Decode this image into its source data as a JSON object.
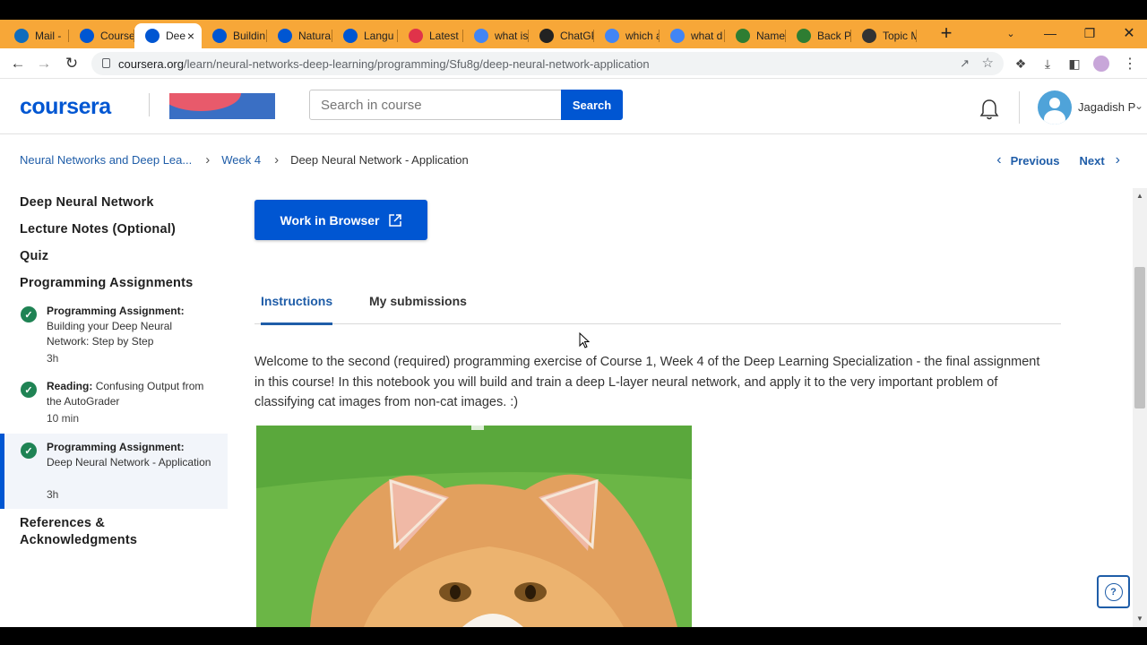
{
  "browser": {
    "tabs": [
      {
        "label": "Mail -",
        "icon": "outlook-icon",
        "color": "#0f6cbd"
      },
      {
        "label": "Course",
        "icon": "coursera-icon",
        "color": "#0056d2"
      },
      {
        "label": "Dee",
        "icon": "coursera-icon",
        "color": "#0056d2",
        "active": true
      },
      {
        "label": "Buildin",
        "icon": "coursera-icon",
        "color": "#0056d2"
      },
      {
        "label": "Natura",
        "icon": "coursera-icon",
        "color": "#0056d2"
      },
      {
        "label": "Langu",
        "icon": "coursera-icon",
        "color": "#0056d2"
      },
      {
        "label": "Latest",
        "icon": "red-site-icon",
        "color": "#e0334a"
      },
      {
        "label": "what is",
        "icon": "google-icon",
        "color": "#4285f4"
      },
      {
        "label": "ChatGP",
        "icon": "chatgpt-icon",
        "color": "#222222"
      },
      {
        "label": "which a",
        "icon": "google-icon",
        "color": "#4285f4"
      },
      {
        "label": "what d",
        "icon": "google-icon",
        "color": "#4285f4"
      },
      {
        "label": "Named",
        "icon": "huggingface-icon",
        "color": "#2e7d32"
      },
      {
        "label": "Back P",
        "icon": "huggingface-icon",
        "color": "#2e7d32"
      },
      {
        "label": "Topic M",
        "icon": "tds-icon",
        "color": "#333333"
      }
    ],
    "url_host": "coursera.org",
    "url_path": "/learn/neural-networks-deep-learning/programming/Sfu8g/deep-neural-network-application"
  },
  "header": {
    "logo": "coursera",
    "search_placeholder": "Search in course",
    "search_button": "Search",
    "user_name": "Jagadish P"
  },
  "breadcrumb": {
    "course": "Neural Networks and Deep Lea...",
    "week": "Week 4",
    "current": "Deep Neural Network - Application"
  },
  "nav": {
    "previous": "Previous",
    "next": "Next"
  },
  "sidebar": {
    "sections": [
      "Deep Neural Network",
      "Lecture Notes (Optional)",
      "Quiz",
      "Programming Assignments"
    ],
    "items": [
      {
        "type": "Programming Assignment:",
        "title": "Building your Deep Neural Network: Step by Step",
        "duration": "3h"
      },
      {
        "type": "Reading:",
        "title": "Confusing Output from the AutoGrader",
        "duration": "10 min"
      },
      {
        "type": "Programming Assignment:",
        "title": "Deep Neural Network - Application",
        "duration": "3h",
        "active": true
      }
    ],
    "footer_section": "References & Acknowledgments"
  },
  "main": {
    "work_button": "Work in Browser",
    "tabs": [
      "Instructions",
      "My submissions"
    ],
    "intro": "Welcome to the second (required) programming exercise of Course 1, Week 4 of the Deep Learning Specialization - the final assignment in this course! In this notebook you will build and train a deep L-layer neural network, and apply it to the very important problem of classifying cat images from non-cat images.  :)"
  },
  "colors": {
    "brand": "#0056d2",
    "link": "#1f5da8",
    "complete": "#1f8354",
    "tabstrip": "#f7a738"
  }
}
